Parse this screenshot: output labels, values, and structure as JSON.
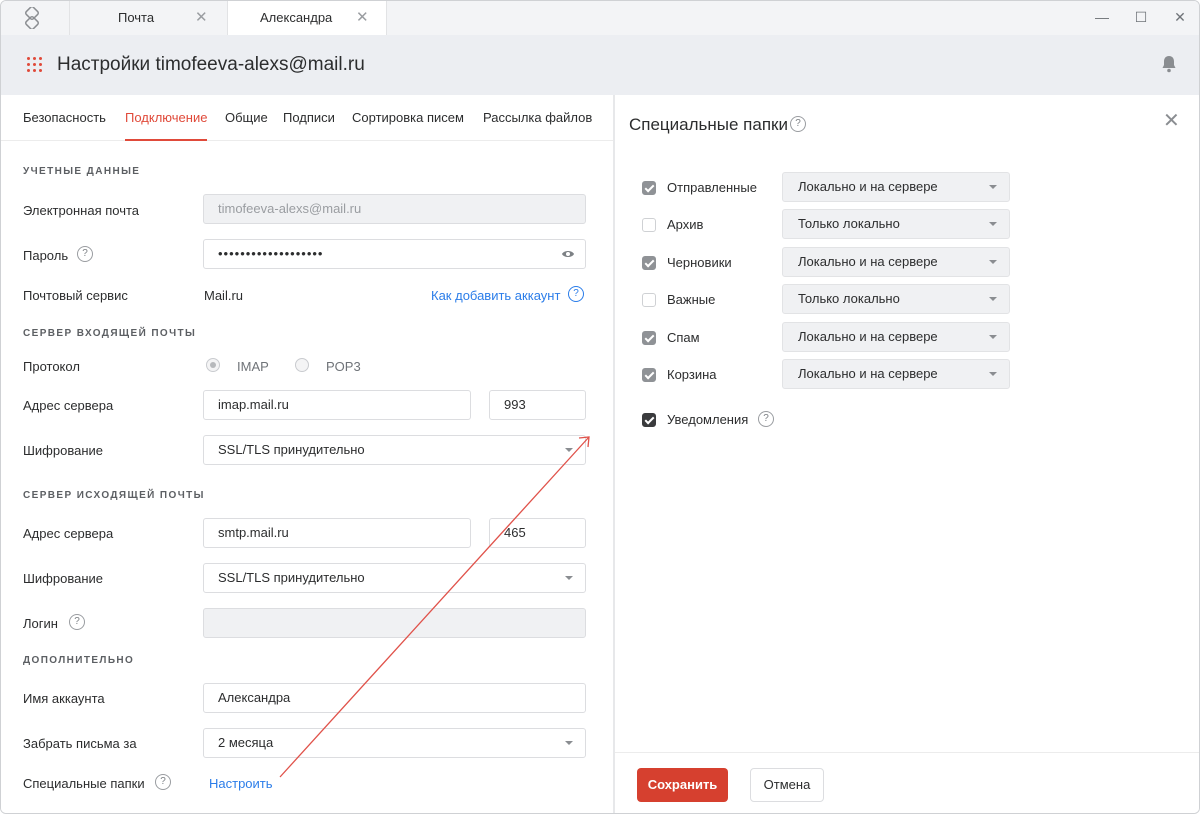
{
  "titlebar": {
    "tabs": [
      {
        "label": "Почта",
        "close": "✕"
      },
      {
        "label": "Александра",
        "close": "✕"
      }
    ],
    "controls": {
      "minimize": "—",
      "maximize": "☐",
      "close": "✕"
    }
  },
  "header": {
    "title": "Настройки timofeeva-alexs@mail.ru"
  },
  "settings_tabs": [
    "Безопасность",
    "Подключение",
    "Общие",
    "Подписи",
    "Сортировка писем",
    "Рассылка файлов"
  ],
  "active_tab": "Подключение",
  "accent_color": "#e04a3a",
  "credentials": {
    "section": "УЧЕТНЫЕ ДАННЫЕ",
    "email_label": "Электронная почта",
    "email_value": "timofeeva-alexs@mail.ru",
    "password_label": "Пароль",
    "password_value": "•••••••••••••••••••",
    "service_label": "Почтовый сервис",
    "service_value": "Mail.ru",
    "add_account_link": "Как добавить аккаунт"
  },
  "incoming": {
    "section": "СЕРВЕР ВХОДЯЩЕЙ ПОЧТЫ",
    "protocol_label": "Протокол",
    "protocol_options": [
      "IMAP",
      "POP3"
    ],
    "protocol_selected": "IMAP",
    "server_label": "Адрес сервера",
    "server_value": "imap.mail.ru",
    "port_value": "993",
    "encryption_label": "Шифрование",
    "encryption_value": "SSL/TLS принудительно"
  },
  "outgoing": {
    "section": "СЕРВЕР ИСХОДЯЩЕЙ ПОЧТЫ",
    "server_label": "Адрес сервера",
    "server_value": "smtp.mail.ru",
    "port_value": "465",
    "encryption_label": "Шифрование",
    "encryption_value": "SSL/TLS принудительно",
    "login_label": "Логин",
    "login_value": ""
  },
  "additional": {
    "section": "ДОПОЛНИТЕЛЬНО",
    "account_name_label": "Имя аккаунта",
    "account_name_value": "Александра",
    "fetch_label": "Забрать письма за",
    "fetch_value": "2 месяца",
    "special_folders_label": "Специальные папки",
    "configure_link": "Настроить"
  },
  "special_folders_panel": {
    "title": "Специальные папки",
    "close": "✕",
    "folders": [
      {
        "name": "Отправленные",
        "checked": true,
        "mode": "Локально и на сервере"
      },
      {
        "name": "Архив",
        "checked": false,
        "mode": "Только локально"
      },
      {
        "name": "Черновики",
        "checked": true,
        "mode": "Локально и на сервере"
      },
      {
        "name": "Важные",
        "checked": false,
        "mode": "Только локально"
      },
      {
        "name": "Спам",
        "checked": true,
        "mode": "Локально и на сервере"
      },
      {
        "name": "Корзина",
        "checked": true,
        "mode": "Локально и на сервере"
      }
    ],
    "notifications_label": "Уведомления",
    "notifications_checked": true,
    "save_label": "Сохранить",
    "cancel_label": "Отмена"
  },
  "help_glyph": "?"
}
